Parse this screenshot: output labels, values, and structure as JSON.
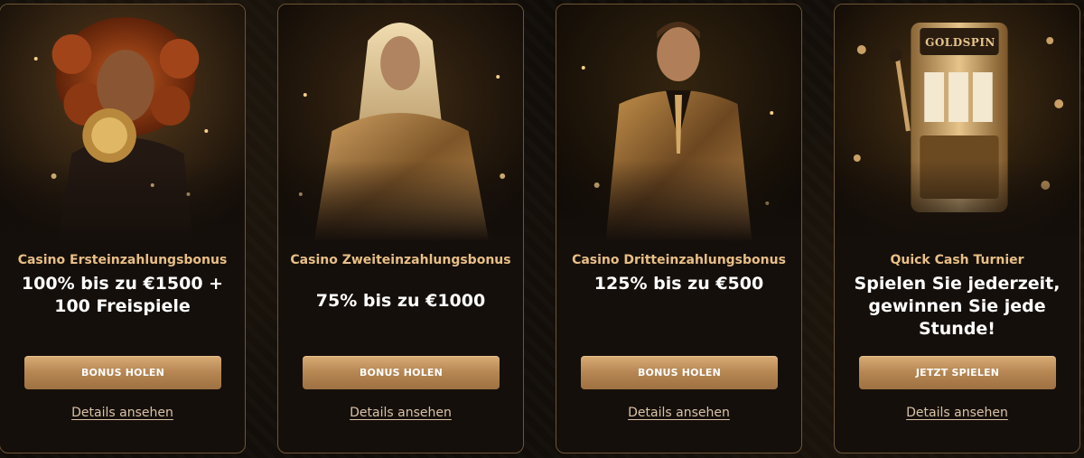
{
  "cards": [
    {
      "subtitle": "Casino Ersteinzahlungsbonus",
      "headline": "100% bis zu €1500 + 100 Freispiele",
      "button_label": "BONUS HOLEN",
      "link_label": "Details ansehen"
    },
    {
      "subtitle": "Casino Zweiteinzahlungsbonus",
      "headline": "75% bis zu €1000",
      "button_label": "BONUS HOLEN",
      "link_label": "Details ansehen"
    },
    {
      "subtitle": "Casino Dritteinzahlungsbonus",
      "headline": "125% bis zu €500",
      "button_label": "BONUS HOLEN",
      "link_label": "Details ansehen"
    },
    {
      "subtitle": "Quick Cash Turnier",
      "headline": "Spielen Sie jederzeit, gewinnen Sie jede Stunde!",
      "button_label": "JETZT SPIELEN",
      "link_label": "Details ansehen",
      "logo_text": "GOLDSPIN"
    }
  ],
  "colors": {
    "accent_gold": "#c89a62",
    "subtitle_gold": "#e8bf86",
    "card_border": "#6e5535",
    "background": "#100c08"
  }
}
